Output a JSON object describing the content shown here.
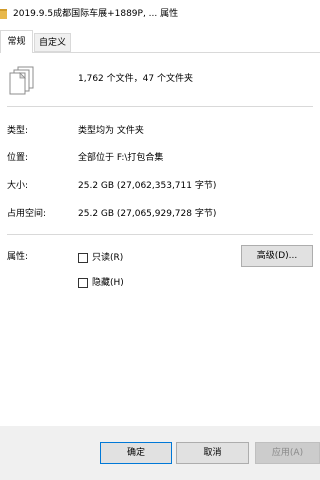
{
  "window": {
    "title": "2019.9.5成都国际车展+1889P, ... 属性"
  },
  "tabs": [
    {
      "label": "常规",
      "active": true
    },
    {
      "label": "自定义",
      "active": false
    }
  ],
  "summary": {
    "text": "1,762 个文件，47 个文件夹",
    "icon": "files-stack-icon"
  },
  "properties": {
    "type": {
      "label": "类型:",
      "value": "类型均为 文件夹"
    },
    "location": {
      "label": "位置:",
      "value": "全部位于 F:\\打包合集"
    },
    "size": {
      "label": "大小:",
      "value": "25.2 GB (27,062,353,711 字节)"
    },
    "size_on_disk": {
      "label": "占用空间:",
      "value": "25.2 GB (27,065,929,728 字节)"
    }
  },
  "attributes": {
    "label": "属性:",
    "readonly": {
      "label": "只读(R)",
      "checked": false
    },
    "hidden": {
      "label": "隐藏(H)",
      "checked": false
    },
    "advanced_button": "高级(D)..."
  },
  "buttons": {
    "ok": "确定",
    "cancel": "取消",
    "apply": "应用(A)"
  },
  "colors": {
    "window_bg": "#ffffff",
    "chrome_bg": "#f0f0f0",
    "separator": "#d9d9d9",
    "button_bg": "#e1e1e1",
    "focus_border": "#0078d7",
    "disabled_text": "#8a8a8a"
  }
}
